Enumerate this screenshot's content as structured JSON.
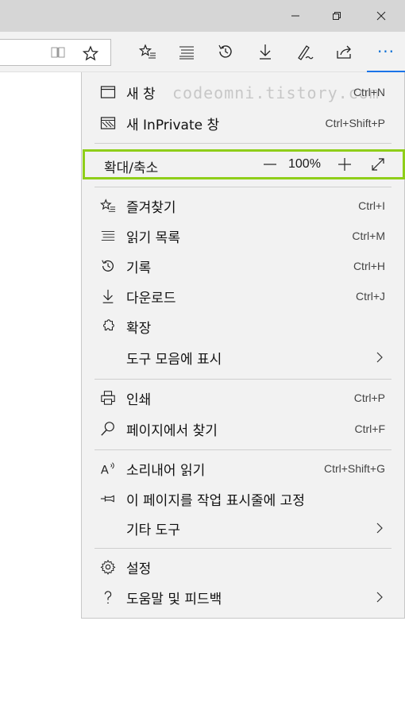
{
  "window_controls": {
    "minimize": "minimize",
    "restore": "restore",
    "close": "close"
  },
  "toolbar": {
    "icons": [
      "reading-view-icon",
      "favorite-star-icon",
      "favorites-icon",
      "reading-list-icon",
      "history-icon",
      "downloads-icon",
      "web-note-icon",
      "share-icon"
    ],
    "more_label": "···"
  },
  "menu": {
    "new_window": {
      "label": "새 창",
      "shortcut": "Ctrl+N"
    },
    "new_private": {
      "label": "새 InPrivate 창",
      "shortcut": "Ctrl+Shift+P"
    },
    "zoom": {
      "label": "확대/축소",
      "value": "100%"
    },
    "favorites": {
      "label": "즐겨찾기",
      "shortcut": "Ctrl+I"
    },
    "reading_list": {
      "label": "읽기 목록",
      "shortcut": "Ctrl+M"
    },
    "history": {
      "label": "기록",
      "shortcut": "Ctrl+H"
    },
    "downloads": {
      "label": "다운로드",
      "shortcut": "Ctrl+J"
    },
    "extensions": {
      "label": "확장"
    },
    "show_in_toolbar": {
      "label": "도구 모음에 표시"
    },
    "print": {
      "label": "인쇄",
      "shortcut": "Ctrl+P"
    },
    "find": {
      "label": "페이지에서 찾기",
      "shortcut": "Ctrl+F"
    },
    "read_aloud": {
      "label": "소리내어 읽기",
      "shortcut": "Ctrl+Shift+G"
    },
    "pin": {
      "label": "이 페이지를 작업 표시줄에 고정"
    },
    "more_tools": {
      "label": "기타 도구"
    },
    "settings": {
      "label": "설정"
    },
    "help": {
      "label": "도움말 및 피드백"
    }
  },
  "watermark": "codeomni.tistory.com",
  "colors": {
    "highlight": "#8fce19",
    "accent": "#0a6fd6"
  }
}
